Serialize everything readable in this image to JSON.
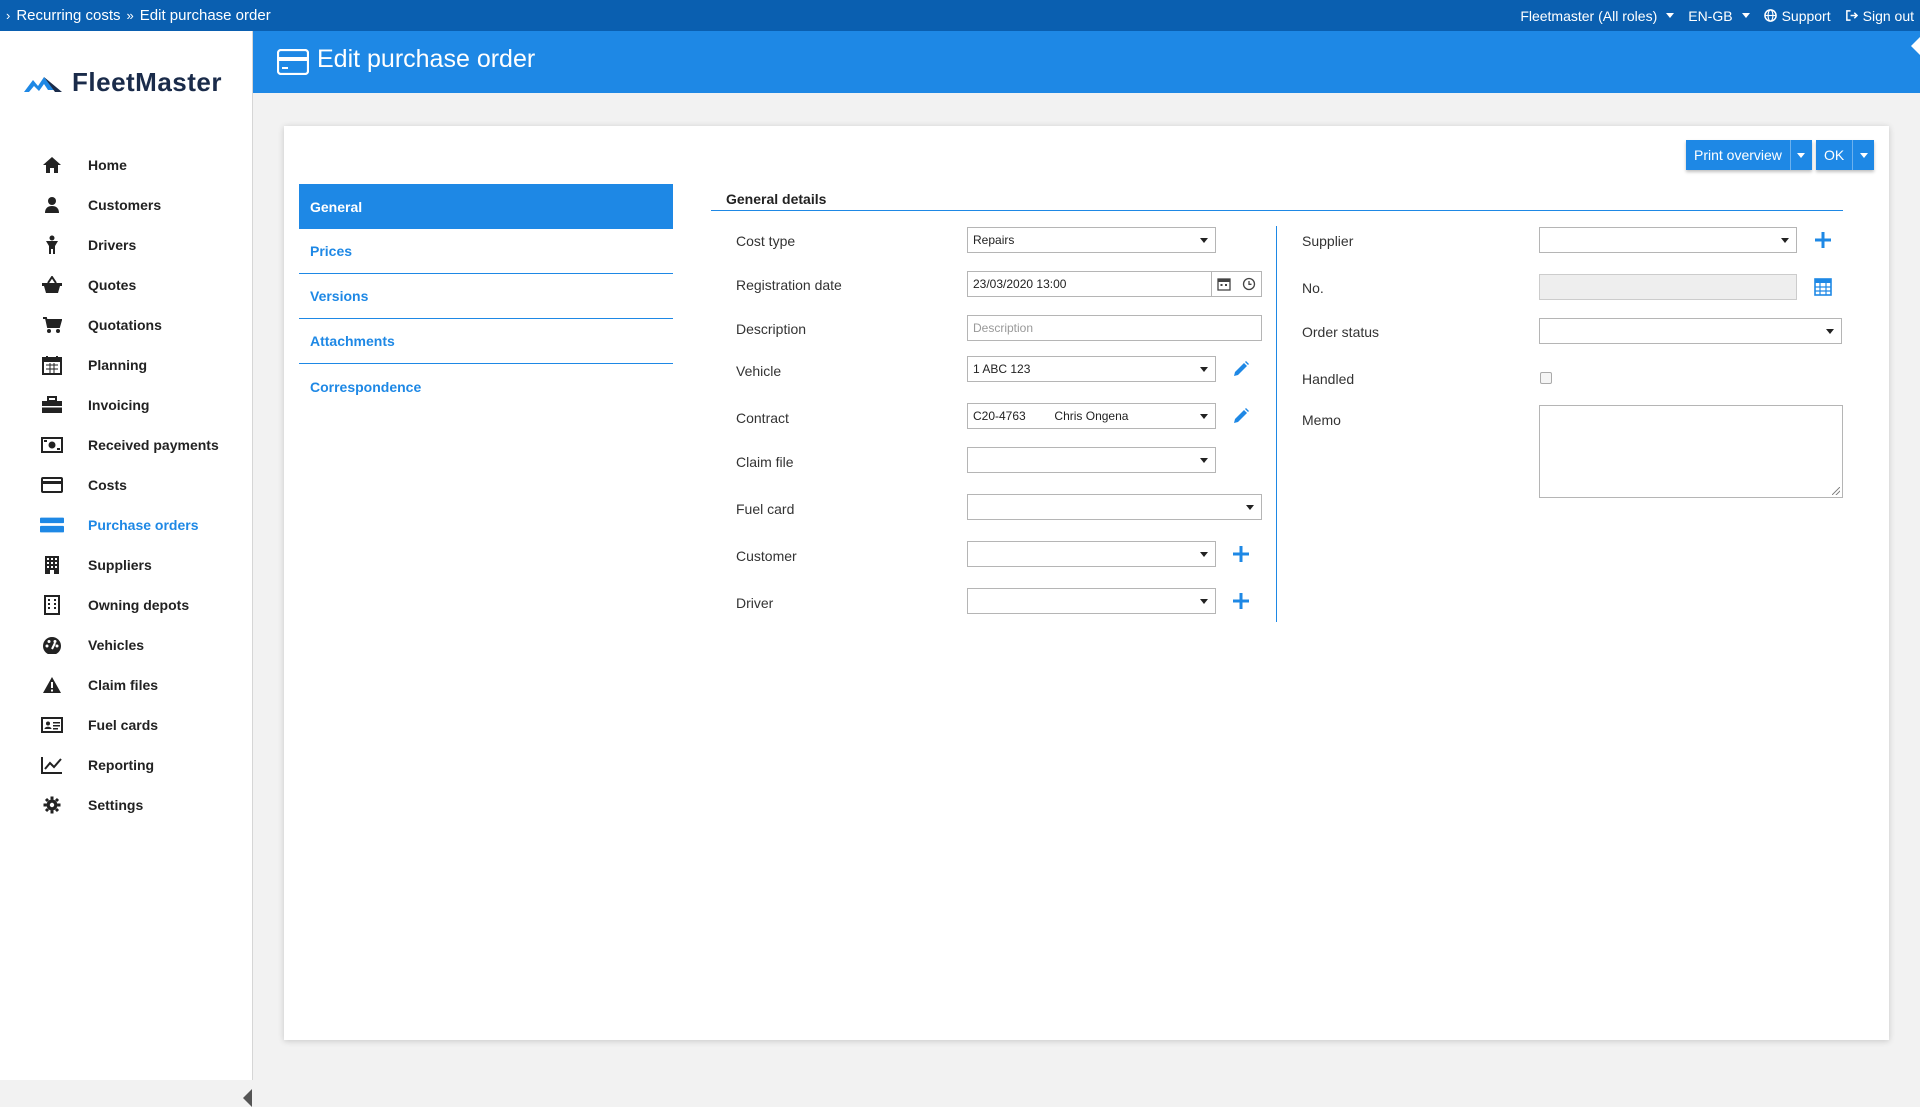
{
  "breadcrumb": {
    "items": [
      "Recurring costs",
      "Edit purchase order"
    ]
  },
  "topbar": {
    "role": "Fleetmaster (All roles)",
    "language": "EN-GB",
    "support": "Support",
    "signout": "Sign out"
  },
  "app": {
    "name": "FleetMaster"
  },
  "sidebar": {
    "items": [
      {
        "label": "Home",
        "icon": "home-icon"
      },
      {
        "label": "Customers",
        "icon": "user-icon"
      },
      {
        "label": "Drivers",
        "icon": "driver-icon"
      },
      {
        "label": "Quotes",
        "icon": "basket-icon"
      },
      {
        "label": "Quotations",
        "icon": "cart-icon"
      },
      {
        "label": "Planning",
        "icon": "calendar-icon"
      },
      {
        "label": "Invoicing",
        "icon": "briefcase-icon"
      },
      {
        "label": "Received payments",
        "icon": "money-icon"
      },
      {
        "label": "Costs",
        "icon": "credit-card-icon"
      },
      {
        "label": "Purchase orders",
        "icon": "purchase-order-icon"
      },
      {
        "label": "Suppliers",
        "icon": "building-icon"
      },
      {
        "label": "Owning depots",
        "icon": "depot-icon"
      },
      {
        "label": "Vehicles",
        "icon": "dashboard-icon"
      },
      {
        "label": "Claim files",
        "icon": "warning-icon"
      },
      {
        "label": "Fuel cards",
        "icon": "id-card-icon"
      },
      {
        "label": "Reporting",
        "icon": "chart-line-icon"
      },
      {
        "label": "Settings",
        "icon": "gear-icon"
      }
    ],
    "active": "Purchase orders"
  },
  "header": {
    "title": "Edit purchase order"
  },
  "toolbar": {
    "print_label": "Print overview",
    "ok_label": "OK"
  },
  "tabs": [
    "General",
    "Prices",
    "Versions",
    "Attachments",
    "Correspondence"
  ],
  "form": {
    "section_title": "General details",
    "cost_type": {
      "label": "Cost type",
      "value": "Repairs"
    },
    "registration_date": {
      "label": "Registration date",
      "value": "23/03/2020 13:00"
    },
    "description": {
      "label": "Description",
      "placeholder": "Description"
    },
    "vehicle": {
      "label": "Vehicle",
      "value": "1 ABC 123"
    },
    "contract": {
      "label": "Contract",
      "code": "C20-4763",
      "name": "Chris Ongena"
    },
    "claim_file": {
      "label": "Claim file",
      "value": ""
    },
    "fuel_card": {
      "label": "Fuel card",
      "value": ""
    },
    "customer": {
      "label": "Customer",
      "value": ""
    },
    "driver": {
      "label": "Driver",
      "value": ""
    },
    "supplier": {
      "label": "Supplier",
      "value": ""
    },
    "number": {
      "label": "No.",
      "value": ""
    },
    "order_status": {
      "label": "Order status",
      "value": ""
    },
    "handled": {
      "label": "Handled",
      "checked": false
    },
    "memo": {
      "label": "Memo",
      "value": ""
    }
  },
  "colors": {
    "topbar": "#0a5fb0",
    "accent": "#1e88e5"
  }
}
